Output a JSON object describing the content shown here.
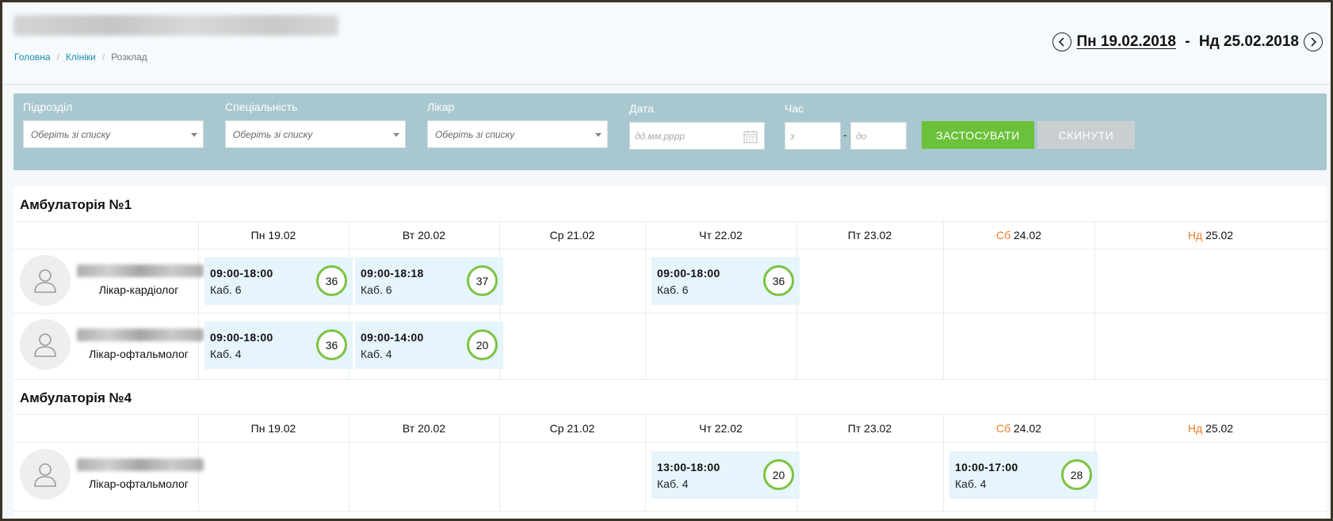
{
  "header": {
    "breadcrumb": [
      {
        "label": "Головна"
      },
      {
        "label": "Клініки"
      },
      {
        "label": "Розклад"
      }
    ],
    "week_start": "Пн 19.02.2018",
    "week_separator": " - ",
    "week_end": "Нд 25.02.2018"
  },
  "filters": {
    "department_label": "Підрозділ",
    "department_placeholder": "Оберіть зі списку",
    "specialty_label": "Спеціальність",
    "specialty_placeholder": "Оберіть зі списку",
    "doctor_label": "Лікар",
    "doctor_placeholder": "Оберіть зі списку",
    "date_label": "Дата",
    "date_placeholder": "дд.мм.рррр",
    "time_label": "Час",
    "time_from_placeholder": "з",
    "time_dash": "-",
    "time_to_placeholder": "до",
    "apply_label": "ЗАСТОСУВАТИ",
    "reset_label": "СКИНУТИ"
  },
  "colors": {
    "accent_link": "#1b8fb0",
    "filter_panel": "#a9c7cf",
    "apply_button": "#6cc13a",
    "reset_button": "#c9cfd1",
    "weekend_day": "#f07a2a",
    "slot_background": "#e6f4fb",
    "count_ring": "#7cc243"
  },
  "days": [
    {
      "abbr": "Пн",
      "date": "19.02"
    },
    {
      "abbr": "Вт",
      "date": "20.02"
    },
    {
      "abbr": "Ср",
      "date": "21.02"
    },
    {
      "abbr": "Чт",
      "date": "22.02"
    },
    {
      "abbr": "Пт",
      "date": "23.02"
    },
    {
      "abbr": "Сб",
      "date": "24.02"
    },
    {
      "abbr": "Нд",
      "date": "25.02"
    }
  ],
  "clinics": [
    {
      "title": "Амбулаторія №1",
      "doctors": [
        {
          "icon": "user-icon",
          "specialty": "Лікар-кардіолог",
          "slots": [
            {
              "time": "09:00-18:00",
              "room": "Каб. 6",
              "count": "36"
            },
            {
              "time": "09:00-18:18",
              "room": "Каб. 6",
              "count": "37"
            },
            {
              "time": "09:00-18:00",
              "room": "Каб. 6",
              "count": "36"
            }
          ]
        },
        {
          "icon": "user-icon",
          "specialty": "Лікар-офтальмолог",
          "slots": [
            {
              "time": "09:00-18:00",
              "room": "Каб. 4",
              "count": "36"
            },
            {
              "time": "09:00-14:00",
              "room": "Каб. 4",
              "count": "20"
            }
          ]
        }
      ]
    },
    {
      "title": "Амбулаторія №4",
      "doctors": [
        {
          "icon": "user-icon",
          "specialty": "Лікар-офтальмолог",
          "slots": [
            {
              "time": "13:00-18:00",
              "room": "Каб. 4",
              "count": "20"
            },
            {
              "time": "10:00-17:00",
              "room": "Каб. 4",
              "count": "28"
            }
          ]
        }
      ]
    }
  ]
}
